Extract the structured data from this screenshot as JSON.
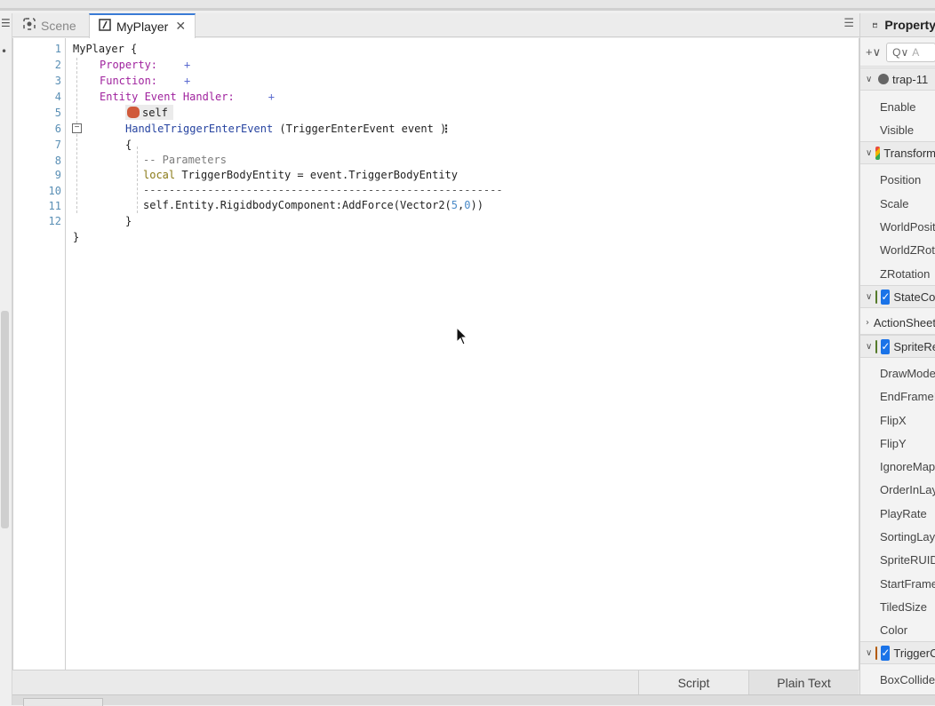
{
  "tabs": [
    {
      "label": "Scene",
      "icon": "scene-icon"
    },
    {
      "label": "MyPlayer",
      "icon": "script-icon",
      "close": "✕"
    }
  ],
  "tab_menu_glyph": "☰",
  "left_glyphs": [
    "☰",
    "•"
  ],
  "editor": {
    "line_numbers": [
      "1",
      "2",
      "3",
      "4",
      "5",
      "6",
      "7",
      "8",
      "9",
      "10",
      "11",
      "12"
    ],
    "lines": {
      "l1": "MyPlayer {",
      "l2_kw": "Property:",
      "l2_plus": "+",
      "l3_kw": "Function:",
      "l3_plus": "+",
      "l4_kw": "Entity Event Handler:",
      "l4_plus": "+",
      "l5_self": "self",
      "l6_fn": "HandleTriggerEnterEvent",
      "l6_args": " (TriggerEnterEvent event )",
      "l6_menu": "⋮",
      "l7": "{",
      "l8": "-- Parameters",
      "l9_local": "local",
      "l9_rest": " TriggerBodyEntity = event.TriggerBodyEntity",
      "l10": "--------------------------------------------------------",
      "l11_a": "self.Entity.RigidbodyComponent:AddForce(Vector2(",
      "l11_n1": "5",
      "l11_comma": ",",
      "l11_n2": "0",
      "l11_b": "))",
      "l12": "}",
      "l13": "}"
    },
    "fold_glyph": "−"
  },
  "bottom_tabs": {
    "script": "Script",
    "plain_text": "Plain Text"
  },
  "property_panel": {
    "title": "Property",
    "add_label": "+∨",
    "search_label": "Q∨",
    "search_placeholder": "A",
    "entity": "trap-11",
    "rows": {
      "enable": "Enable",
      "visible": "Visible",
      "transform": "Transform",
      "position": "Position",
      "scale": "Scale",
      "world_position": "WorldPosition",
      "world_z_rotation": "WorldZRotation",
      "z_rotation": "ZRotation",
      "state_component": "StateComponent",
      "action_sheet": "ActionSheet",
      "sprite_renderer": "SpriteRenderer",
      "draw_mode": "DrawMode",
      "end_frame": "EndFrameIndex",
      "flip_x": "FlipX",
      "flip_y": "FlipY",
      "ignore_map": "IgnoreMapLayerCheck",
      "order_in_layer": "OrderInLayer",
      "play_rate": "PlayRate",
      "sorting_layer": "SortingLayer",
      "sprite_ruid": "SpriteRUID",
      "start_frame": "StartFrameIndex",
      "tiled_size": "TiledSize",
      "color": "Color",
      "trigger_component": "TriggerComponent",
      "box_collider": "BoxColliderOffset"
    },
    "checkbox_glyph": "✓",
    "chevron_down": "∨",
    "chevron_right": "›"
  },
  "colors": {
    "accent": "#1a73e8",
    "keyword": "#a0239e",
    "function": "#2643a0",
    "local": "#8a7a17",
    "number": "#4a8ac8",
    "line_number": "#5a8fb5"
  }
}
